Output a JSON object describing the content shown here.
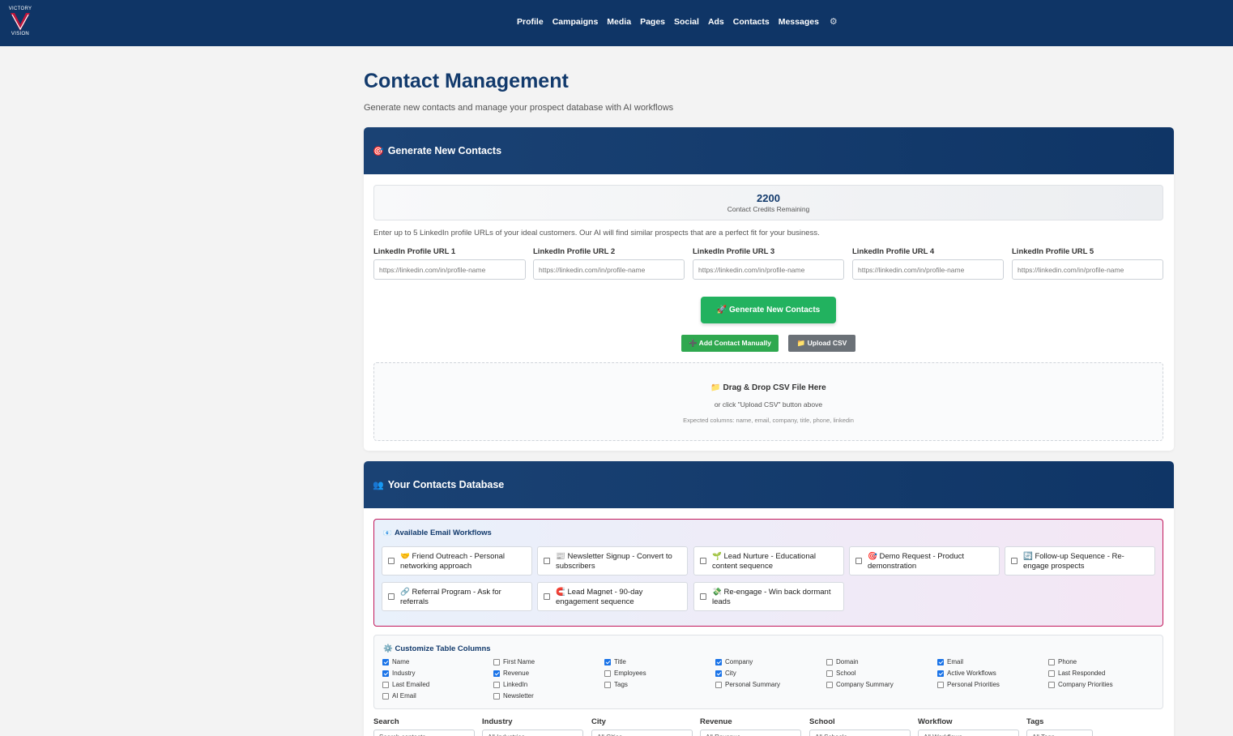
{
  "app": {
    "logo_top": "VICTORY",
    "logo_bottom": "VISION"
  },
  "nav": {
    "links": [
      "Profile",
      "Campaigns",
      "Media",
      "Pages",
      "Social",
      "Ads",
      "Contacts",
      "Messages"
    ],
    "settings_icon": "gear-icon"
  },
  "page": {
    "title": "Contact Management",
    "subtitle": "Generate new contacts and manage your prospect database with AI workflows"
  },
  "generate": {
    "header": "Generate New Contacts",
    "header_icon": "🎯",
    "credits_value": "2200",
    "credits_label": "Contact Credits Remaining",
    "instructions": "Enter up to 5 LinkedIn profile URLs of your ideal customers. Our AI will find similar prospects that are a perfect fit for your business.",
    "url_fields": [
      {
        "label": "LinkedIn Profile URL 1",
        "placeholder": "https://linkedin.com/in/profile-name"
      },
      {
        "label": "LinkedIn Profile URL 2",
        "placeholder": "https://linkedin.com/in/profile-name"
      },
      {
        "label": "LinkedIn Profile URL 3",
        "placeholder": "https://linkedin.com/in/profile-name"
      },
      {
        "label": "LinkedIn Profile URL 4",
        "placeholder": "https://linkedin.com/in/profile-name"
      },
      {
        "label": "LinkedIn Profile URL 5",
        "placeholder": "https://linkedin.com/in/profile-name"
      }
    ],
    "generate_button": "🚀 Generate New Contacts",
    "add_manual_button": "➕ Add Contact Manually",
    "upload_csv_button": "📁 Upload CSV",
    "drop_title": "📁 Drag & Drop CSV File Here",
    "drop_hint": "or click \"Upload CSV\" button above",
    "drop_columns": "Expected columns: name, email, company, title, phone, linkedin"
  },
  "database": {
    "header": "Your Contacts Database",
    "header_icon": "👥",
    "workflows_title": "Available Email Workflows",
    "workflows_icon": "📧",
    "workflows": [
      "🤝 Friend Outreach - Personal networking approach",
      "📰 Newsletter Signup - Convert to subscribers",
      "🌱 Lead Nurture - Educational content sequence",
      "🎯 Demo Request - Product demonstration",
      "🔄 Follow-up Sequence - Re-engage prospects",
      "🔗 Referral Program - Ask for referrals",
      "🧲 Lead Magnet - 90-day engagement sequence",
      "💸 Re-engage - Win back dormant leads"
    ],
    "columns_title": "Customize Table Columns",
    "columns_icon": "⚙️",
    "columns": [
      {
        "label": "Name",
        "checked": true
      },
      {
        "label": "First Name",
        "checked": false
      },
      {
        "label": "Title",
        "checked": true
      },
      {
        "label": "Company",
        "checked": true
      },
      {
        "label": "Domain",
        "checked": false
      },
      {
        "label": "Email",
        "checked": true
      },
      {
        "label": "Phone",
        "checked": false
      },
      {
        "label": "Industry",
        "checked": true
      },
      {
        "label": "Revenue",
        "checked": true
      },
      {
        "label": "Employees",
        "checked": false
      },
      {
        "label": "City",
        "checked": true
      },
      {
        "label": "School",
        "checked": false
      },
      {
        "label": "Active Workflows",
        "checked": true
      },
      {
        "label": "Last Responded",
        "checked": false
      },
      {
        "label": "Last Emailed",
        "checked": false
      },
      {
        "label": "LinkedIn",
        "checked": false
      },
      {
        "label": "Tags",
        "checked": false
      },
      {
        "label": "Personal Summary",
        "checked": false
      },
      {
        "label": "Company Summary",
        "checked": false
      },
      {
        "label": "Personal Priorities",
        "checked": false
      },
      {
        "label": "Company Priorities",
        "checked": false
      },
      {
        "label": "AI Email",
        "checked": false
      },
      {
        "label": "Newsletter",
        "checked": false
      }
    ],
    "filters": [
      {
        "label": "Search",
        "value": "Search contacts..."
      },
      {
        "label": "Industry",
        "value": "All Industries"
      },
      {
        "label": "City",
        "value": "All Cities"
      },
      {
        "label": "Revenue",
        "value": "All Revenue"
      },
      {
        "label": "School",
        "value": "All Schools"
      },
      {
        "label": "Workflow",
        "value": "All Workflows"
      },
      {
        "label": "Tags",
        "value": "All Tags"
      }
    ]
  }
}
